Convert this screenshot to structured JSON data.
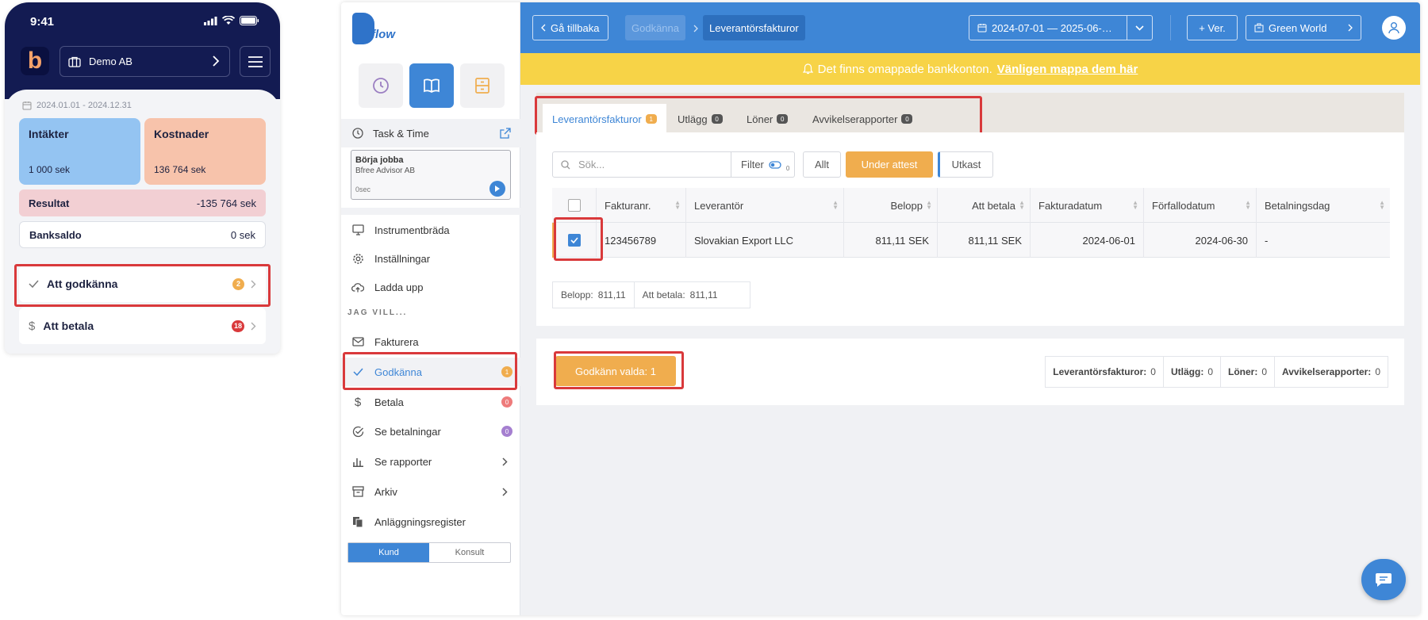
{
  "phone": {
    "status_time": "9:41",
    "company": "Demo AB",
    "date_range": "2024.01.01 - 2024.12.31",
    "income_title": "Intäkter",
    "income_value": "1 000 sek",
    "cost_title": "Kostnader",
    "cost_value": "136 764 sek",
    "result_label": "Resultat",
    "result_value": "-135 764 sek",
    "bank_label": "Banksaldo",
    "bank_value": "0 sek",
    "approve_label": "Att godkänna",
    "approve_count": "2",
    "pay_label": "Att betala",
    "pay_count": "18"
  },
  "sidebar": {
    "brand_text": "flow",
    "task_title": "Task & Time",
    "task_card": {
      "title": "Börja jobba",
      "company": "Bfree Advisor AB",
      "timer": "0sec"
    },
    "nav_top": [
      {
        "label": "Instrumentbräda"
      },
      {
        "label": "Inställningar"
      },
      {
        "label": "Ladda upp"
      }
    ],
    "section_label": "JAG VILL...",
    "nav_main": [
      {
        "label": "Fakturera"
      },
      {
        "label": "Godkänna",
        "badge": "1"
      },
      {
        "label": "Betala",
        "badge": "0"
      },
      {
        "label": "Se betalningar",
        "badge": "0"
      },
      {
        "label": "Se rapporter"
      },
      {
        "label": "Arkiv"
      },
      {
        "label": "Anläggningsregister"
      }
    ],
    "toggle_on": "Kund",
    "toggle_off": "Konsult"
  },
  "topbar": {
    "back": "Gå tillbaka",
    "crumb1": "Godkänna",
    "crumb2": "Leverantörsfakturor",
    "date_range": "2024-07-01 — 2025-06-…",
    "add_ver": "+ Ver.",
    "company": "Green World"
  },
  "banner": {
    "text": "Det finns omappade bankkonton.",
    "link": "Vänligen mappa dem här"
  },
  "tabs": [
    {
      "label": "Leverantörsfakturor",
      "count": "1"
    },
    {
      "label": "Utlägg",
      "count": "0"
    },
    {
      "label": "Löner",
      "count": "0"
    },
    {
      "label": "Avvikelserapporter",
      "count": "0"
    }
  ],
  "filters": {
    "search_placeholder": "Sök...",
    "filter_label": "Filter",
    "filter_count": "0",
    "seg_all": "Allt",
    "seg_attest": "Under attest",
    "seg_draft": "Utkast"
  },
  "table": {
    "columns": [
      "Fakturanr.",
      "Leverantör",
      "Belopp",
      "Att betala",
      "Fakturadatum",
      "Förfallodatum",
      "Betalningsdag"
    ],
    "rows": [
      {
        "invoice": "123456789",
        "supplier": "Slovakian Export LLC",
        "amount": "811,11 SEK",
        "to_pay": "811,11 SEK",
        "invoice_date": "2024-06-01",
        "due_date": "2024-06-30",
        "pay_day": "-"
      }
    ]
  },
  "totals": {
    "amount_label": "Belopp:",
    "amount_value": "811,11",
    "to_pay_label": "Att betala:",
    "to_pay_value": "811,11"
  },
  "footer": {
    "approve_button": "Godkänn valda: 1",
    "summary": [
      {
        "label": "Leverantörsfakturor:",
        "value": "0"
      },
      {
        "label": "Utlägg:",
        "value": "0"
      },
      {
        "label": "Löner:",
        "value": "0"
      },
      {
        "label": "Avvikelserapporter:",
        "value": "0"
      }
    ]
  },
  "colors": {
    "primary": "#3e86d6",
    "accent": "#f0ad4e",
    "highlight": "#d9393b",
    "banner": "#f7d347",
    "phone_header": "#131b52"
  }
}
